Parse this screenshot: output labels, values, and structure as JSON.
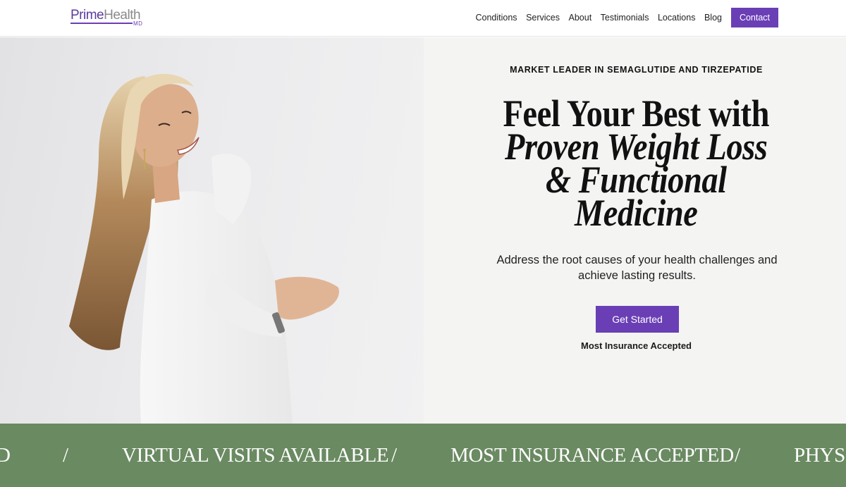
{
  "brand": {
    "logo_prime": "Prime",
    "logo_health": "Health",
    "logo_md": "MD"
  },
  "nav": {
    "items": [
      "Conditions",
      "Services",
      "About",
      "Testimonials",
      "Locations",
      "Blog"
    ],
    "contact": "Contact"
  },
  "hero": {
    "eyebrow": "MARKET LEADER IN SEMAGLUTIDE AND TIRZEPATIDE",
    "headline_line1": "Feel Your Best with",
    "headline_line2": "Proven Weight Loss",
    "headline_line3": "& Functional",
    "headline_line4": "Medicine",
    "subtitle": "Address the root causes of your health challenges and achieve lasting results.",
    "cta": "Get Started",
    "insurance": "Most Insurance Accepted"
  },
  "marquee": {
    "items": [
      "D",
      "VIRTUAL VISITS AVAILABLE",
      "MOST INSURANCE ACCEPTED",
      "PHYSIC"
    ],
    "separator": "/"
  },
  "colors": {
    "accent": "#6a3fb5",
    "marquee_bg": "#6a8a61",
    "hero_bg": "#f4f4f3"
  }
}
